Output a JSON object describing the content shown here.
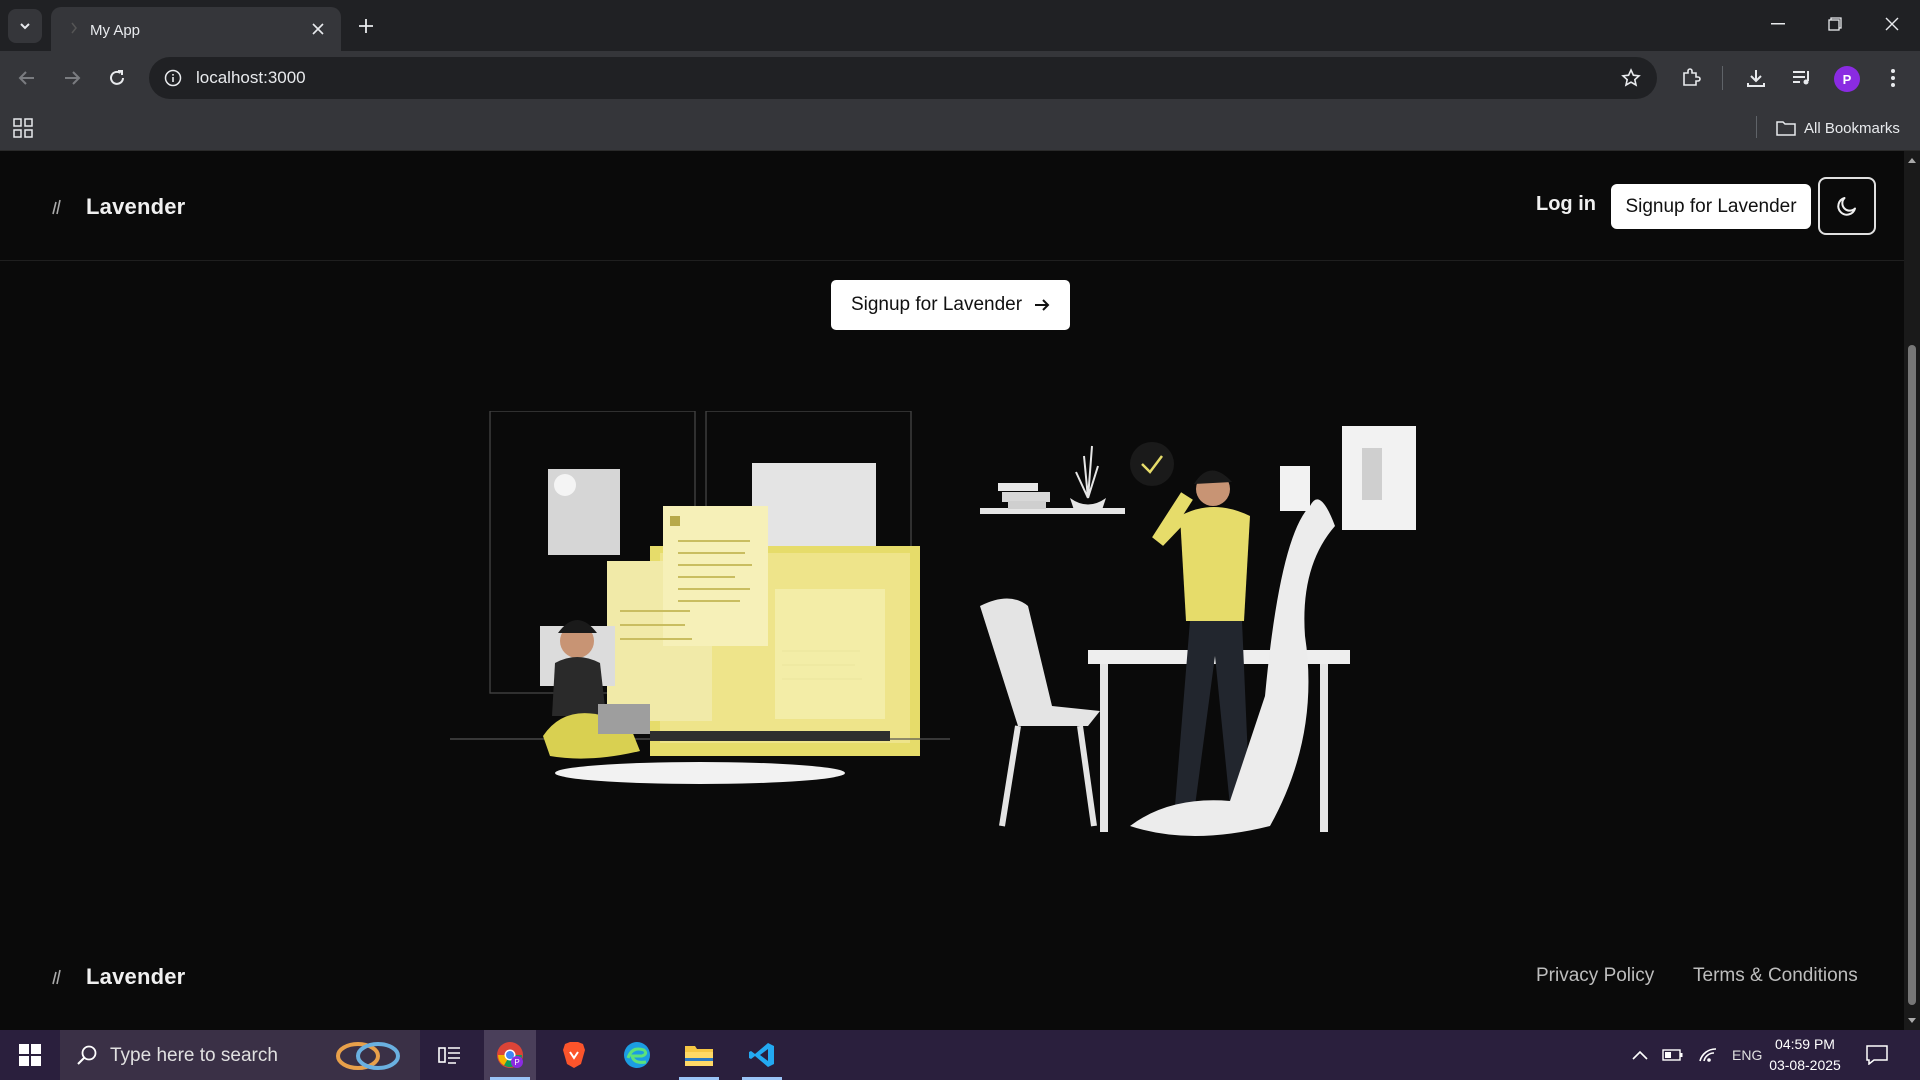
{
  "browser": {
    "tab_title": "My App",
    "url": "localhost:3000",
    "bookmarks_label": "All Bookmarks",
    "profile_initial": "P"
  },
  "site": {
    "brand": "Lavender",
    "nav": {
      "login": "Log in",
      "signup": "Signup for Lavender"
    },
    "cta": "Signup for Lavender",
    "footer": {
      "brand": "Lavender",
      "privacy": "Privacy Policy",
      "terms": "Terms & Conditions"
    }
  },
  "taskbar": {
    "search_placeholder": "Type here to search",
    "language": "ENG",
    "time": "04:59 PM",
    "date": "03-08-2025"
  },
  "icons": [
    "tab-search-icon",
    "favicon",
    "close-icon",
    "plus-icon",
    "minimize-icon",
    "restore-icon",
    "back-icon",
    "forward-icon",
    "reload-icon",
    "site-info-icon",
    "bookmark-star-icon",
    "extensions-icon",
    "download-icon",
    "media-icon",
    "menu-icon",
    "apps-grid-icon",
    "folder-icon",
    "lavender-logo-icon",
    "moon-icon",
    "arrow-right-icon",
    "windows-start-icon",
    "search-icon",
    "task-view-icon",
    "chrome-icon",
    "brave-icon",
    "edge-icon",
    "file-explorer-icon",
    "vscode-icon",
    "chevron-up-icon",
    "battery-icon",
    "wifi-icon",
    "notification-icon"
  ]
}
